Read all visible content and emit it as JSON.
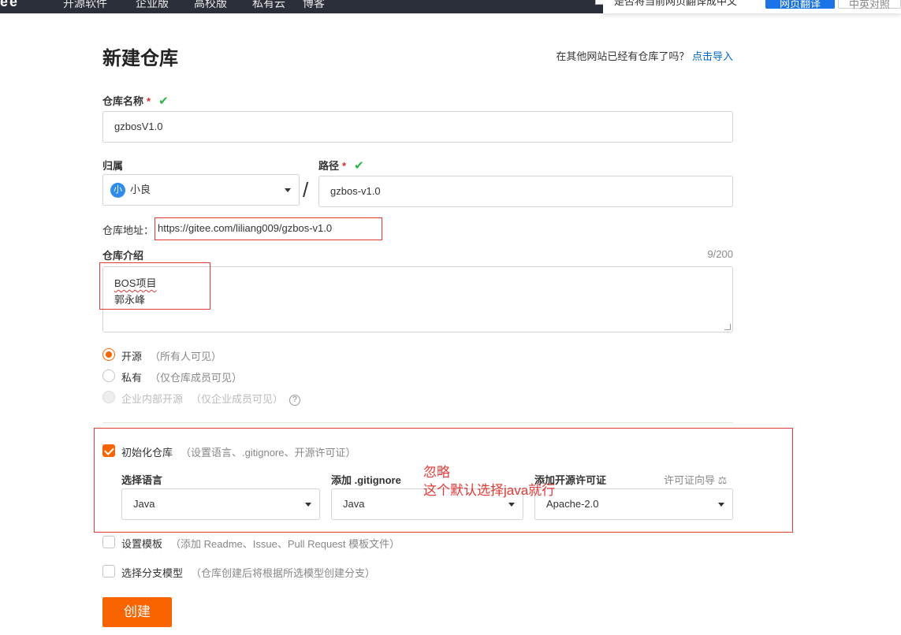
{
  "topnav": {
    "logo": "ee",
    "items": [
      "开源软件",
      "企业版",
      "高校版",
      "私有云",
      "博客"
    ]
  },
  "popup": {
    "text": "是否将当前网页翻译成中文",
    "confirm": "网页翻译",
    "cancel": "中英对照"
  },
  "page": {
    "title": "新建仓库",
    "import_prompt": "在其他网站已经有仓库了吗？",
    "import_link": "点击导入"
  },
  "form": {
    "repo_name_label": "仓库名称",
    "repo_name_value": "gzbosV1.0",
    "required_mark": "*",
    "check_mark": "✔",
    "owner_label": "归属",
    "owner_avatar": "小",
    "owner_value": "小良",
    "slash": "/",
    "path_label": "路径",
    "path_value": "gzbos-v1.0",
    "address_label": "仓库地址：",
    "address_value": "https://gitee.com/liliang009/gzbos-v1.0",
    "intro_label": "仓库介绍",
    "intro_counter": "9/200",
    "intro_line1": "BOS项目",
    "intro_line2": "郭永峰"
  },
  "visibility": {
    "open_label": "开源",
    "open_hint": "（所有人可见）",
    "private_label": "私有",
    "private_hint": "（仅仓库成员可见）",
    "internal_label": "企业内部开源",
    "internal_hint": "（仅企业成员可见）",
    "help_icon": "?"
  },
  "init": {
    "label": "初始化仓库",
    "hint": "（设置语言、.gitignore、开源许可证）",
    "language_label": "选择语言",
    "language_value": "Java",
    "gitignore_label": "添加 .gitignore",
    "gitignore_value": "Java",
    "license_label": "添加开源许可证",
    "license_guide": "许可证向导 ⚖",
    "license_value": "Apache-2.0"
  },
  "template": {
    "label": "设置模板",
    "hint": "（添加 Readme、Issue、Pull Request 模板文件）"
  },
  "branch": {
    "label": "选择分支模型",
    "hint": "（仓库创建后将根据所选模型创建分支）"
  },
  "annotation": {
    "line1": "忽略",
    "line2": "这个默认选择java就行"
  },
  "submit_label": "创建",
  "colors": {
    "accent": "#fa6400",
    "link": "#0066cc",
    "annotation_red": "#e53935",
    "success_green": "#21ba45"
  }
}
